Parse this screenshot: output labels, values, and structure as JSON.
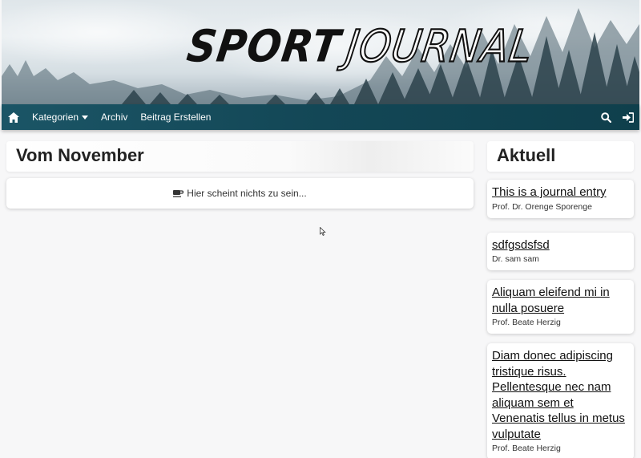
{
  "brand": {
    "part1": "SPORT",
    "part2": "JOURNAL"
  },
  "nav": {
    "home_icon": "home-icon",
    "items": [
      {
        "label": "Kategorien",
        "has_dropdown": true
      },
      {
        "label": "Archiv"
      },
      {
        "label": "Beitrag Erstellen"
      }
    ],
    "right_icons": [
      "search-icon",
      "sign-in-icon"
    ]
  },
  "main": {
    "title": "Vom November",
    "empty_message": "Hier scheint nichts zu sein..."
  },
  "sidebar": {
    "title": "Aktuell",
    "entries": [
      {
        "title": "This is a journal entry",
        "author": "Prof. Dr. Orenge Sporenge"
      },
      {
        "title": "sdfgsdsfsd",
        "author": "Dr. sam sam"
      },
      {
        "title": "Aliquam eleifend mi in nulla posuere",
        "author": "Prof. Beate Herzig"
      },
      {
        "title": "Diam donec adipiscing tristique risus. Pellentesque nec nam aliquam sem et Venenatis tellus in metus vulputate",
        "author": "Prof. Beate Herzig"
      }
    ]
  },
  "colors": {
    "navbar": "#134756",
    "accent": "#1b5566",
    "background": "#f7f7f8"
  }
}
